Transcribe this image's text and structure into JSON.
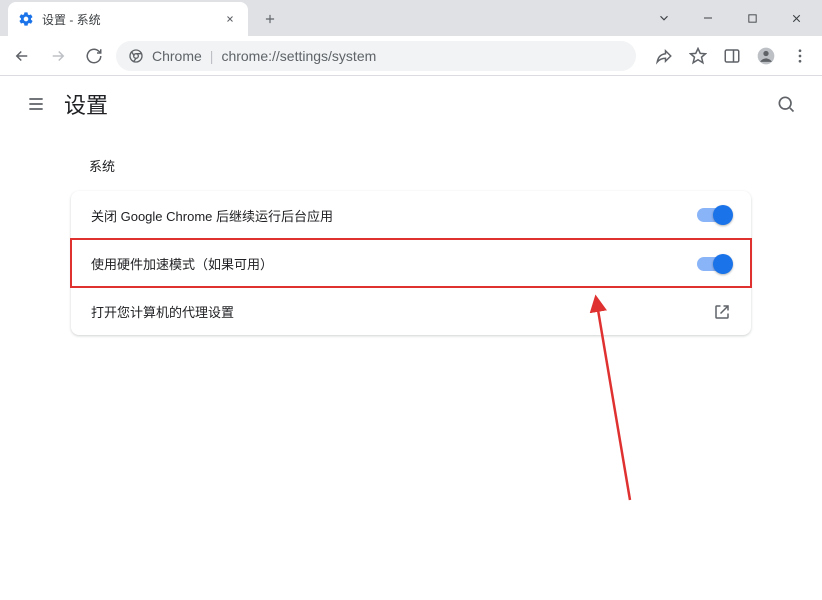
{
  "browser": {
    "tab": {
      "title": "设置 - 系统"
    },
    "omnibox": {
      "origin_label": "Chrome",
      "url": "chrome://settings/system"
    }
  },
  "settings": {
    "page_title": "设置",
    "section_title": "系统",
    "rows": {
      "bg_apps": "关闭 Google Chrome 后继续运行后台应用",
      "hw_accel": "使用硬件加速模式（如果可用）",
      "proxy": "打开您计算机的代理设置"
    }
  }
}
